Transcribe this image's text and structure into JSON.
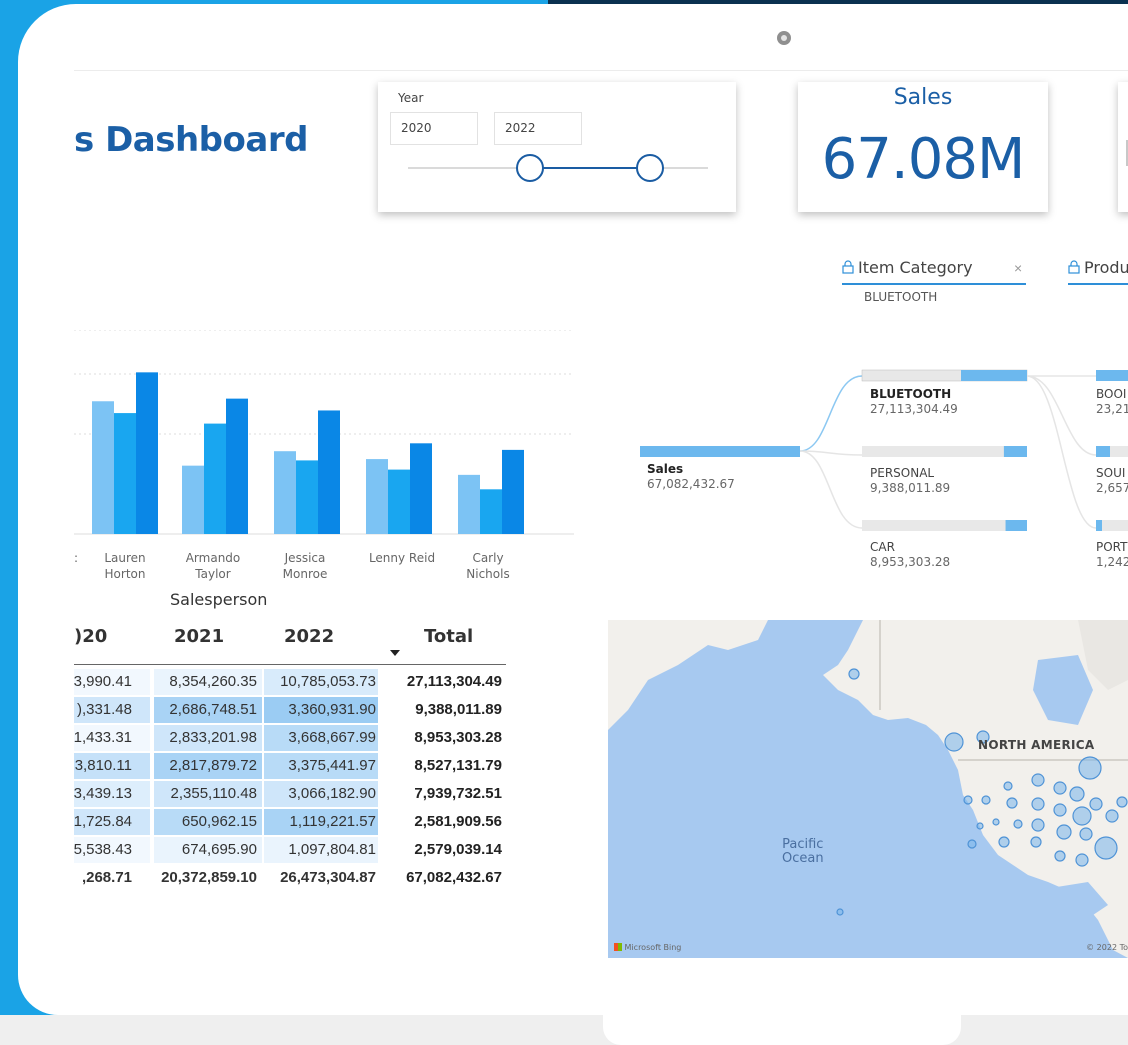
{
  "dashboard": {
    "title": "s Dashboard"
  },
  "year_slicer": {
    "label": "Year",
    "start": "2020",
    "end": "2022"
  },
  "kpi": {
    "title": "Sales",
    "value": "67.08M"
  },
  "filters": [
    {
      "label": "Item Category",
      "value": "BLUETOOTH"
    },
    {
      "label": "Produ",
      "value": ""
    }
  ],
  "chart_data": {
    "type": "bar",
    "xlabel": "Salesperson",
    "categories": [
      {
        "line1": ":",
        "line2": ""
      },
      {
        "line1": "Lauren",
        "line2": "Horton"
      },
      {
        "line1": "Armando",
        "line2": "Taylor"
      },
      {
        "line1": "Jessica",
        "line2": "Monroe"
      },
      {
        "line1": "Lenny Reid",
        "line2": ""
      },
      {
        "line1": "Carly",
        "line2": "Nichols"
      }
    ],
    "series": [
      {
        "values": [
          null,
          101,
          52,
          63,
          57,
          45
        ]
      },
      {
        "values": [
          null,
          92,
          84,
          56,
          49,
          34
        ]
      },
      {
        "values": [
          null,
          123,
          103,
          94,
          69,
          64
        ]
      }
    ],
    "colors": [
      "#7cc3f4",
      "#19a6f0",
      "#0a87e6"
    ],
    "ylim": [
      0,
      140
    ],
    "grid": true
  },
  "sales_table": {
    "headers": [
      ")20",
      "2021",
      "2022",
      "Total"
    ],
    "rows": [
      {
        "c2020": "3,990.41",
        "c2021": "8,354,260.35",
        "c2022": "10,785,053.73",
        "total": "27,113,304.49"
      },
      {
        "c2020": "),331.48",
        "c2021": "2,686,748.51",
        "c2022": "3,360,931.90",
        "total": "9,388,011.89"
      },
      {
        "c2020": "1,433.31",
        "c2021": "2,833,201.98",
        "c2022": "3,668,667.99",
        "total": "8,953,303.28"
      },
      {
        "c2020": "3,810.11",
        "c2021": "2,817,879.72",
        "c2022": "3,375,441.97",
        "total": "8,527,131.79"
      },
      {
        "c2020": "3,439.13",
        "c2021": "2,355,110.48",
        "c2022": "3,066,182.90",
        "total": "7,939,732.51"
      },
      {
        "c2020": "1,725.84",
        "c2021": "650,962.15",
        "c2022": "1,119,221.57",
        "total": "2,581,909.56"
      },
      {
        "c2020": "5,538.43",
        "c2021": "674,695.90",
        "c2022": "1,097,804.81",
        "total": "2,579,039.14"
      }
    ],
    "total_row": {
      "c2020": ",268.71",
      "c2021": "20,372,859.10",
      "c2022": "26,473,304.87",
      "total": "67,082,432.67"
    }
  },
  "decomp_tree": {
    "root": {
      "label": "Sales",
      "value": "67,082,432.67"
    },
    "level1": [
      {
        "label": "BLUETOOTH",
        "value": "27,113,304.49",
        "share": 0.4
      },
      {
        "label": "PERSONAL",
        "value": "9,388,011.89",
        "share": 0.14
      },
      {
        "label": "CAR",
        "value": "8,953,303.28",
        "share": 0.13
      }
    ],
    "level2": [
      {
        "label": "BOOI",
        "value": "23,21"
      },
      {
        "label": "SOUI",
        "value": "2,657"
      },
      {
        "label": "PORT",
        "value": "1,242"
      }
    ]
  },
  "map": {
    "ocean_label_line1": "Pacific",
    "ocean_label_line2": "Ocean",
    "continent_label": "NORTH AMERICA",
    "attribution": "Microsoft Bing",
    "copyright": "© 2022 To"
  }
}
